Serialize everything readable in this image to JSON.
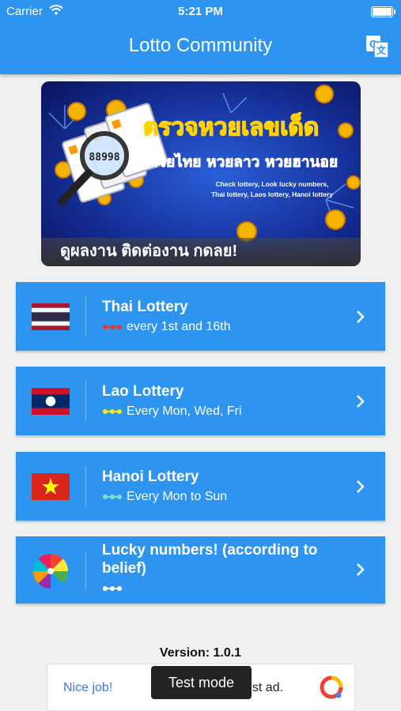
{
  "status_bar": {
    "carrier": "Carrier",
    "time": "5:21 PM"
  },
  "app_bar": {
    "title": "Lotto Community",
    "translate_icon": "translate-icon"
  },
  "banner": {
    "caption": "ดูผลงาน ติดต่องาน กดลย!",
    "headline": "ตรวจหวยเลขเด็ด",
    "subheadline": "หวยไทย หวยลาว หวยฮานอย",
    "english_line1": "Check lottery, Look lucky numbers,",
    "english_line2": "Thai lottery, Laos lottery, Hanoi lottery"
  },
  "menu": [
    {
      "name": "Thai Lottery",
      "schedule": "every 1st and 16th",
      "flag": "thailand-flag-icon",
      "dot_color": "#e53935"
    },
    {
      "name": "Lao Lottery",
      "schedule": "Every Mon, Wed, Fri",
      "flag": "laos-flag-icon",
      "dot_color": "#ffee00"
    },
    {
      "name": "Hanoi Lottery",
      "schedule": "Every Mon to Sun",
      "flag": "vietnam-flag-icon",
      "dot_color": "#7fe0c8"
    },
    {
      "name": "Lucky numbers! (according to belief)",
      "schedule": "",
      "flag": "wheel-icon",
      "dot_color": "#ffffff"
    }
  ],
  "version": "Version: 1.0.1",
  "ad": {
    "nice": "Nice job!",
    "rest": "est ad.",
    "toast": "Test mode"
  },
  "colors": {
    "primary": "#2d95f0",
    "background": "#f0f0f0"
  }
}
